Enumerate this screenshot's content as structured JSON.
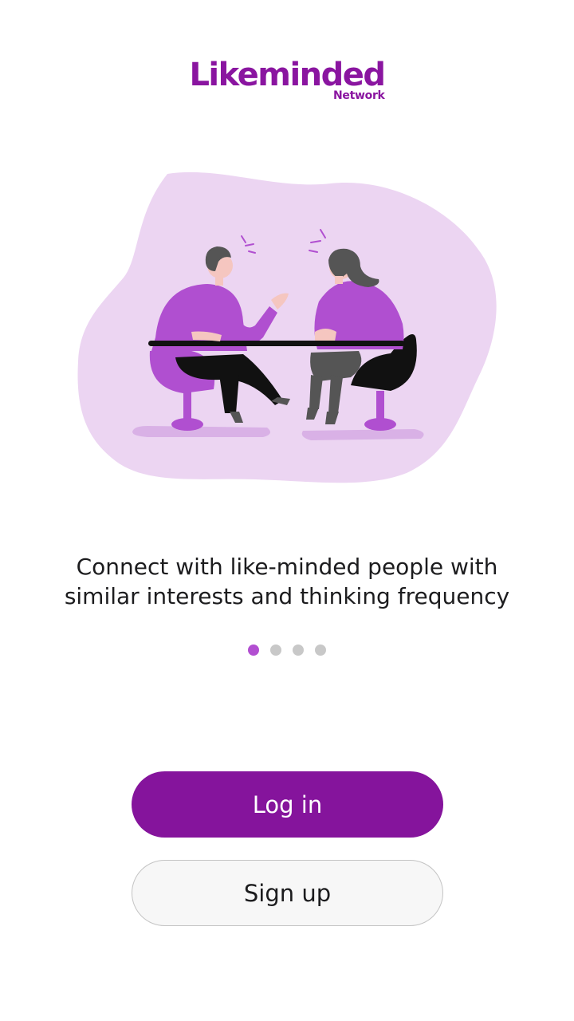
{
  "logo": {
    "title": "Likeminded",
    "subtitle": "Network"
  },
  "onboarding": {
    "illustration": "two-people-talking-at-table-illustration",
    "tagline_line1": "Connect with like-minded people with",
    "tagline_line2": "similar interests and thinking frequency",
    "page_count": 4,
    "active_page": 1
  },
  "actions": {
    "login_label": "Log in",
    "signup_label": "Sign up"
  },
  "colors": {
    "brand": "#85149c",
    "accent": "#b24fd1",
    "blob": "#ecd5f2",
    "inactive_dot": "#c8c8c8"
  }
}
